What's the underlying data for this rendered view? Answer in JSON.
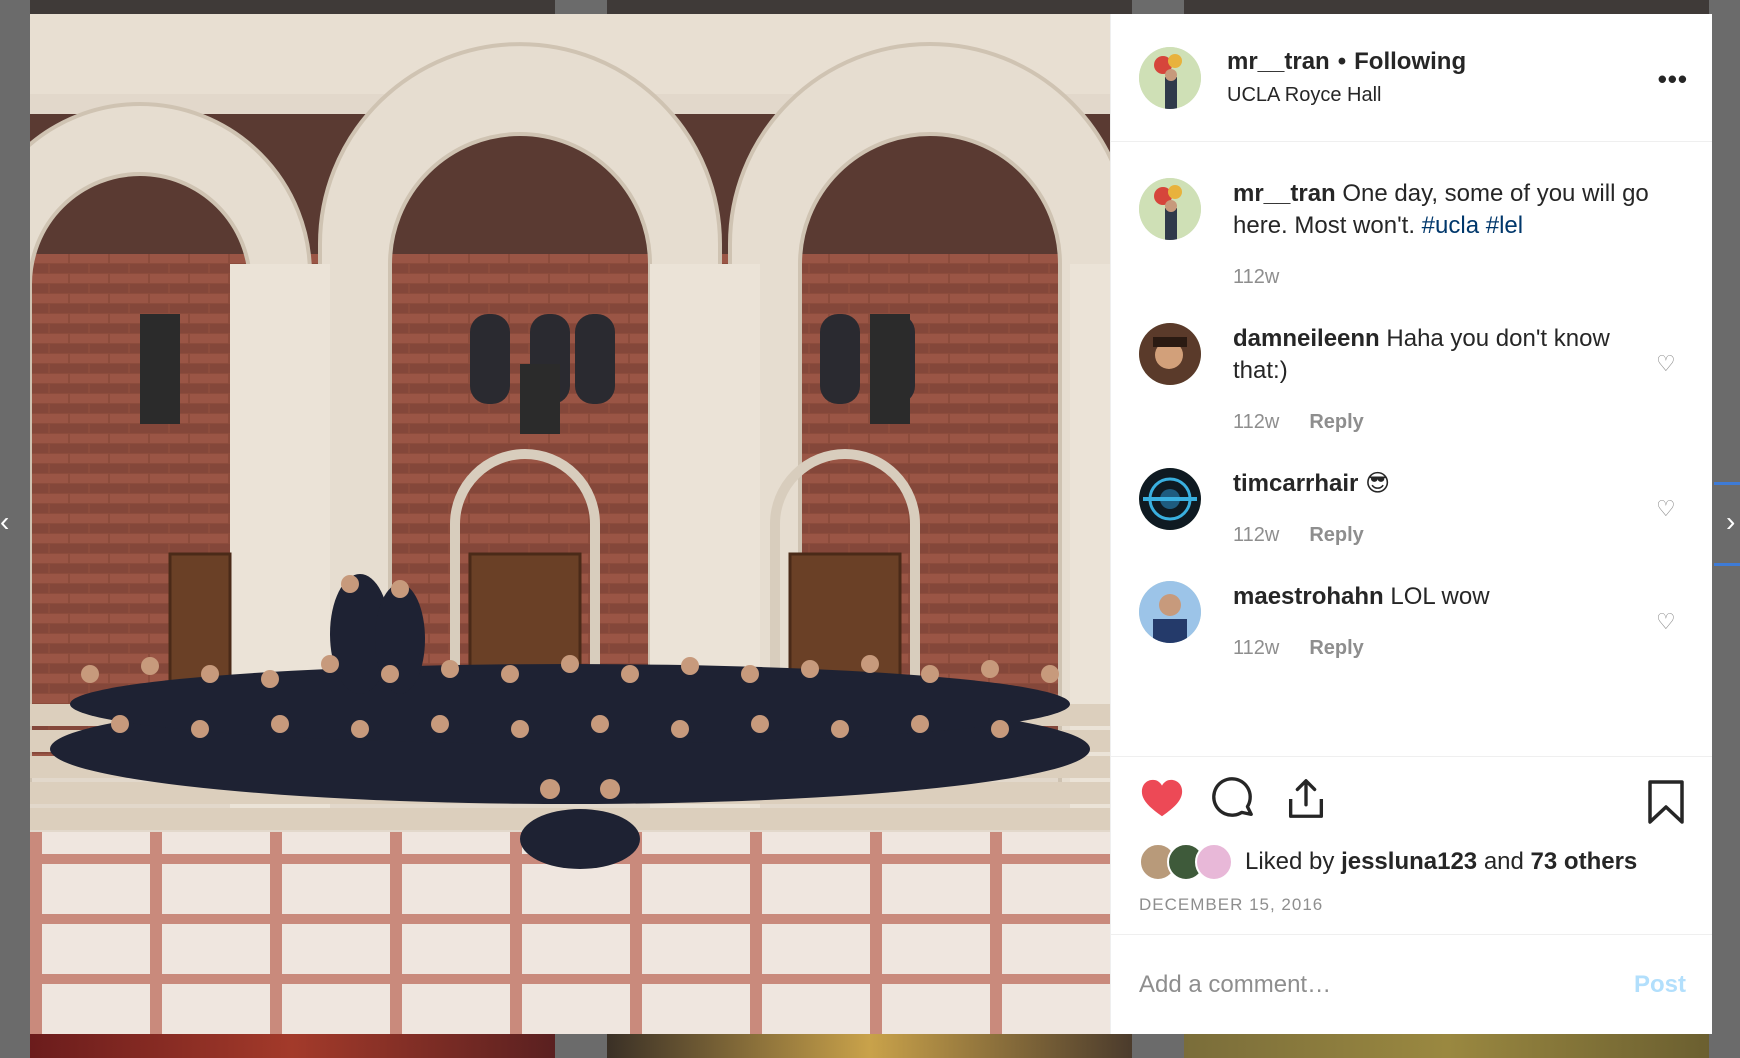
{
  "post": {
    "username": "mr__tran",
    "separator": "•",
    "follow_status": "Following",
    "location": "UCLA Royce Hall",
    "more_icon": "more-horizontal-icon"
  },
  "caption": {
    "username": "mr__tran",
    "text": "One day, some of you will go here. Most won't.",
    "hashtags": [
      "#ucla",
      "#lel"
    ],
    "age": "112w"
  },
  "comments": [
    {
      "username": "damneileenn",
      "text": "Haha you don't know that:)",
      "age": "112w",
      "reply_label": "Reply"
    },
    {
      "username": "timcarrhair",
      "text": "😎",
      "age": "112w",
      "reply_label": "Reply"
    },
    {
      "username": "maestrohahn",
      "text": "LOL wow",
      "age": "112w",
      "reply_label": "Reply"
    }
  ],
  "likes": {
    "prefix": "Liked by",
    "first_user": "jessluna123",
    "joiner": "and",
    "others": "73 others"
  },
  "date": "DECEMBER 15, 2016",
  "add_comment": {
    "placeholder": "Add a comment…",
    "post_label": "Post"
  },
  "colors": {
    "like_active": "#ed4956",
    "hashtag": "#00376b",
    "post_disabled": "#b2dffc",
    "secondary_text": "#8e8e8e"
  }
}
